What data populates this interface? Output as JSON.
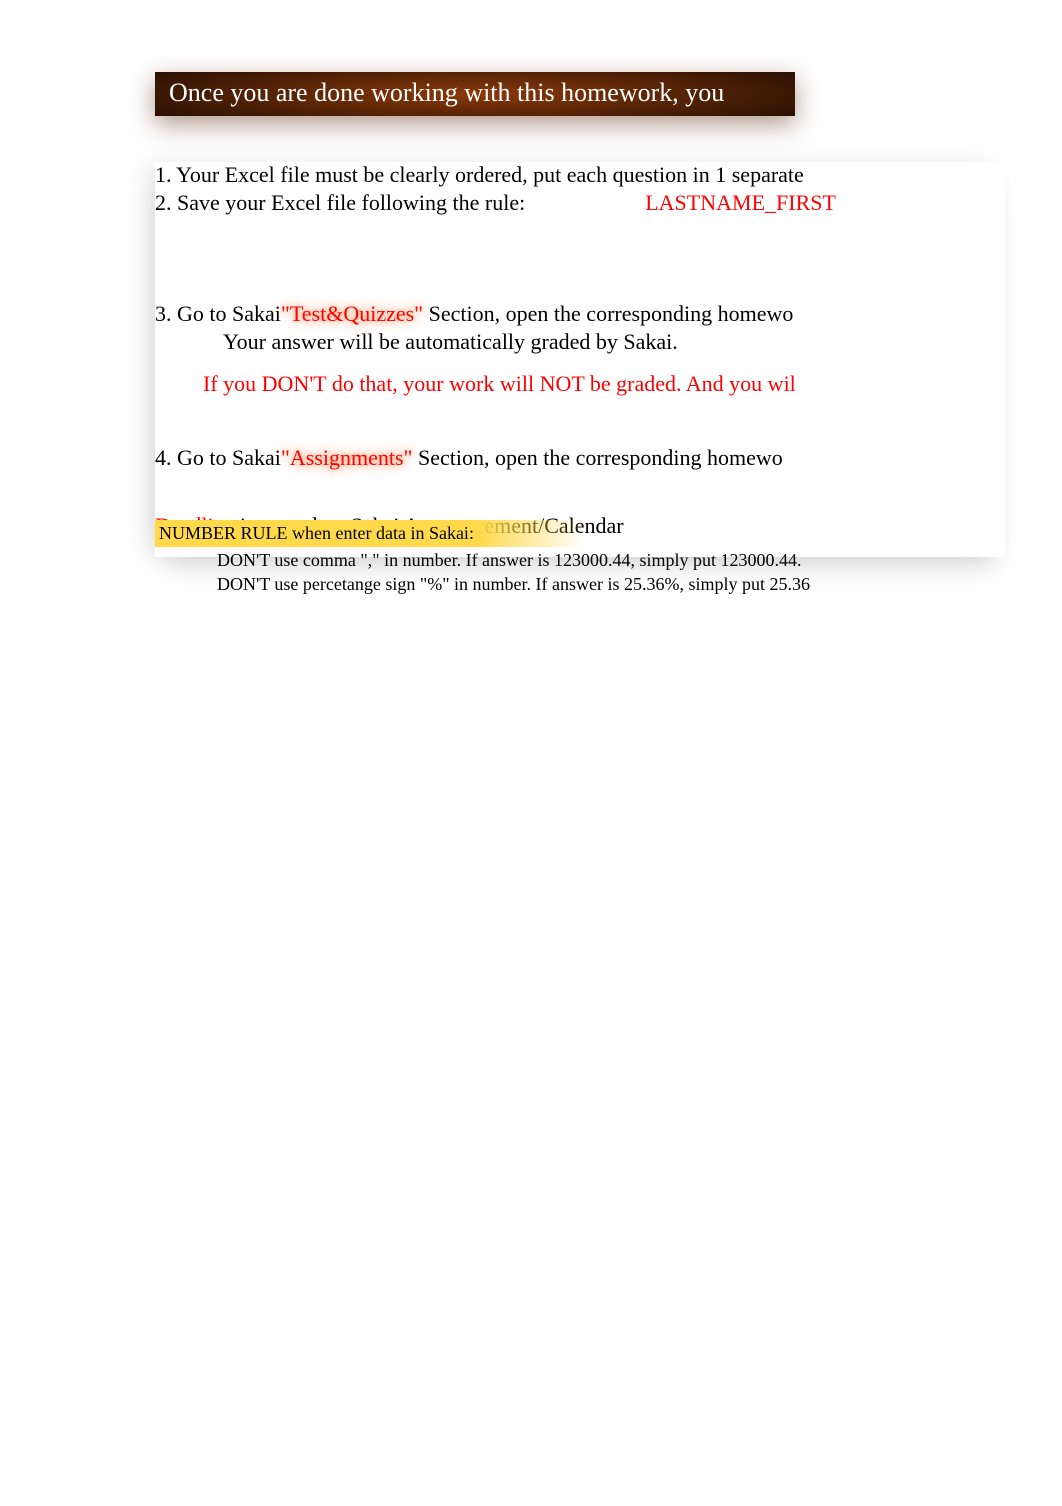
{
  "header": {
    "title": "Once you are done working with this homework, you"
  },
  "instructions": {
    "item1": "1. Your Excel file must be clearly ordered, put each question in 1 separate",
    "item2_prefix": "2. Save your Excel file following the rule:",
    "item2_rule": "LASTNAME_FIRST",
    "item3_prefix": "3. Go to Sakai",
    "item3_section": "\"Test&Quizzes\" ",
    "item3_suffix": "Section, open the corresponding homewo",
    "item3_line2": "Your answer will be automatically graded by Sakai.",
    "item3_warning": "If you DON'T do that, your work will NOT be graded. And you wil",
    "item4_prefix": "4. Go to Sakai",
    "item4_section": "\"Assignments\" ",
    "item4_suffix": "Section, open the corresponding homewo",
    "deadline_label": "Deadline ",
    "deadline_text": "is posted on Sakai Announcement/Calendar"
  },
  "number_rule": {
    "title": "NUMBER RULE when enter data in Sakai:",
    "line1": "DON'T use comma \",\" in number. If answer is 123000.44, simply put 123000.44.",
    "line2": "DON'T use percetange sign \"%\" in number. If answer is 25.36%, simply put 25.36"
  }
}
